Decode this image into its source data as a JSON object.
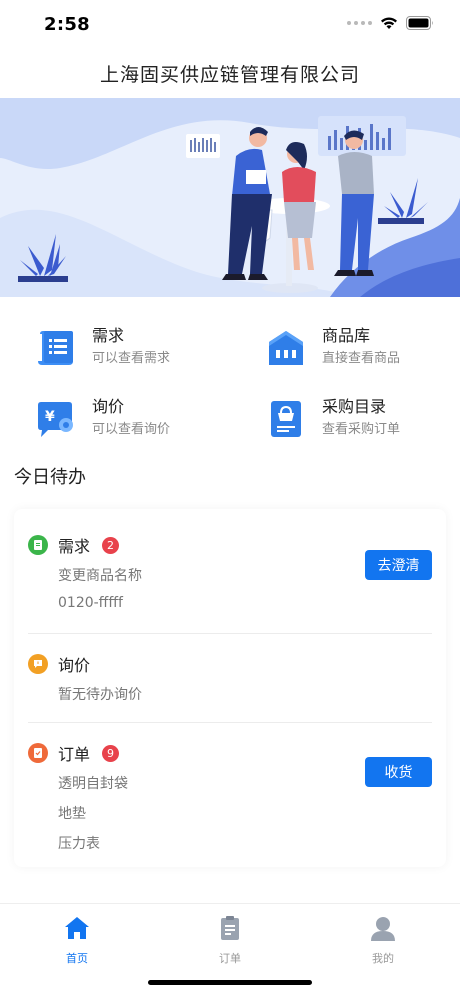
{
  "status_bar": {
    "time": "2:58"
  },
  "app": {
    "title": "上海固买供应链管理有限公司"
  },
  "quick_menu": [
    {
      "title": "需求",
      "subtitle": "可以查看需求",
      "icon": "document-list-icon"
    },
    {
      "title": "商品库",
      "subtitle": "直接查看商品",
      "icon": "warehouse-icon"
    },
    {
      "title": "询价",
      "subtitle": "可以查看询价",
      "icon": "price-inquiry-icon"
    },
    {
      "title": "采购目录",
      "subtitle": "查看采购订单",
      "icon": "purchase-catalog-icon"
    }
  ],
  "todo": {
    "section_title": "今日待办",
    "items": [
      {
        "label": "需求",
        "badge": "2",
        "lines": [
          "变更商品名称",
          "0120-fffff"
        ],
        "button": "去澄清",
        "icon": "demand-icon",
        "color": "#3bb54a"
      },
      {
        "label": "询价",
        "lines": [
          "暂无待办询价"
        ],
        "icon": "inquiry-icon",
        "color": "#f2a024"
      },
      {
        "label": "订单",
        "badge": "9",
        "lines": [
          "透明自封袋",
          "地垫",
          "压力表"
        ],
        "button": "收货",
        "icon": "order-icon",
        "color": "#ef6a3a"
      }
    ]
  },
  "tab_bar": {
    "tabs": [
      {
        "label": "首页",
        "icon": "home-icon",
        "active": true
      },
      {
        "label": "订单",
        "icon": "clipboard-icon",
        "active": false
      },
      {
        "label": "我的",
        "icon": "user-icon",
        "active": false
      }
    ],
    "active_color": "#1275f0",
    "inactive_color": "#999999"
  }
}
